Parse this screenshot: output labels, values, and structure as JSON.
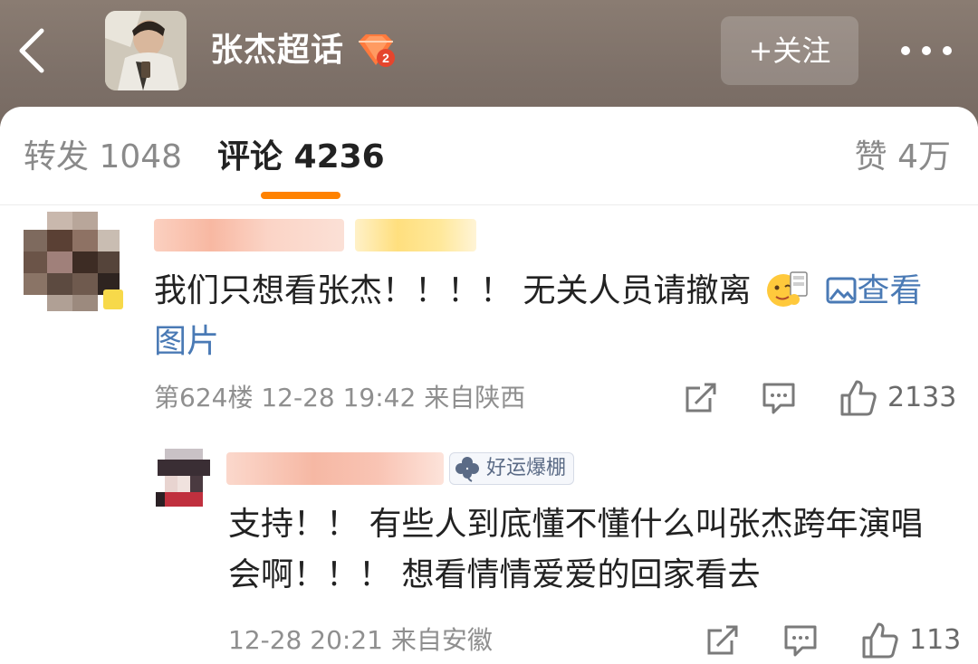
{
  "header": {
    "title": "张杰超话",
    "follow_label": "+关注",
    "level": "2"
  },
  "tabs": {
    "repost": "转发 1048",
    "comment": "评论 4236",
    "like": "赞 4万"
  },
  "comments": [
    {
      "text": "我们只想看张杰！！！！ 无关人员请撤离",
      "view_picture": "查看图片",
      "meta": "第624楼  12-28 19:42  来自陕西",
      "likes": "2133"
    },
    {
      "badge": "好运爆棚",
      "text": "支持！！ 有些人到底懂不懂什么叫张杰跨年演唱会啊！！！  想看情情爱爱的回家看去",
      "meta": "12-28 20:21  来自安徽",
      "likes": "113"
    }
  ],
  "colors": {
    "accent": "#ff8200",
    "link": "#4a7ab5",
    "meta": "#8f8f8f"
  },
  "icons": [
    "back-arrow-icon",
    "vip-level-icon",
    "more-icon",
    "repost-icon",
    "comment-icon",
    "like-icon",
    "clover-icon",
    "picture-icon",
    "emoji-icon"
  ]
}
